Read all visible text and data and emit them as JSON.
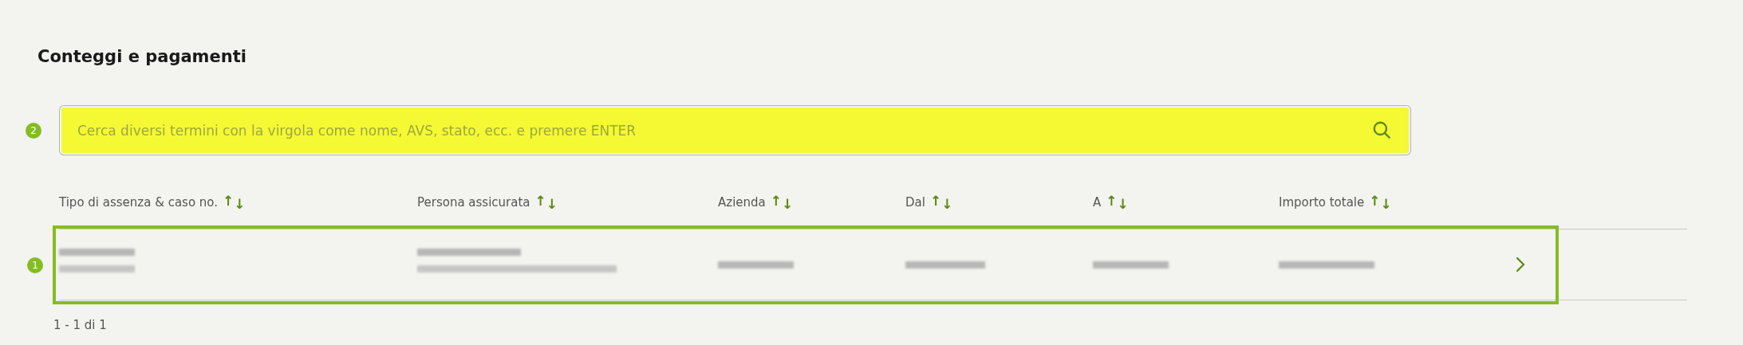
{
  "title": "Conteggi e pagamenti",
  "search": {
    "marker": "2",
    "placeholder": "Cerca diversi termini con la virgola come nome, AVS, stato, ecc. e premere ENTER"
  },
  "table": {
    "columns": [
      {
        "label": "Tipo di assenza & caso no.",
        "sort_up": "↑",
        "sort_down": "↓"
      },
      {
        "label": "Persona assicurata",
        "sort_up": "↑",
        "sort_down": "↓"
      },
      {
        "label": "Azienda",
        "sort_up": "↑",
        "sort_down": "↓"
      },
      {
        "label": "Dal",
        "sort_up": "↑",
        "sort_down": "↓"
      },
      {
        "label": "A",
        "sort_up": "↑",
        "sort_down": "↓"
      },
      {
        "label": "Importo totale",
        "sort_up": "↑",
        "sort_down": "↓"
      }
    ],
    "rows": [
      {
        "marker": "1",
        "highlighted": true,
        "cells": [
          {
            "kind": "blurred-two-line"
          },
          {
            "kind": "blurred-two-line"
          },
          {
            "kind": "blurred"
          },
          {
            "kind": "blurred"
          },
          {
            "kind": "blurred"
          },
          {
            "kind": "blurred"
          }
        ]
      }
    ]
  },
  "pagination": "1 - 1 di 1"
}
